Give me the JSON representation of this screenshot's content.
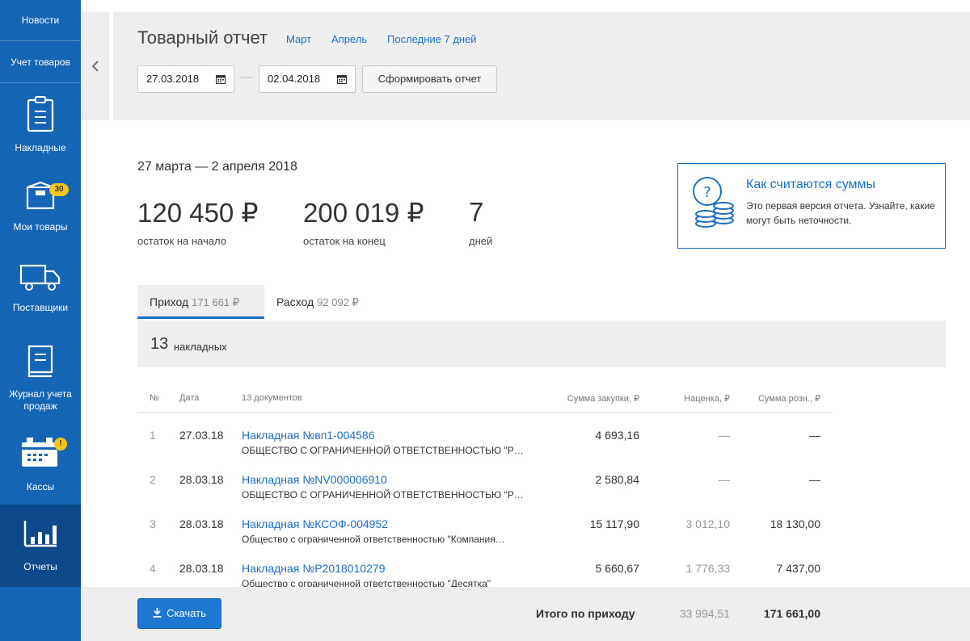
{
  "sidebar": {
    "top_items": [
      "Новости",
      "Учет товаров"
    ],
    "items": [
      {
        "label": "Накладные",
        "icon": "clipboard-icon"
      },
      {
        "label": "Мои товары",
        "icon": "box-icon",
        "badge": "30"
      },
      {
        "label": "Поставщики",
        "icon": "truck-icon"
      },
      {
        "label": "Журнал учета продаж",
        "icon": "book-icon"
      },
      {
        "label": "Кассы",
        "icon": "register-icon",
        "badge": "!"
      },
      {
        "label": "Отчеты",
        "icon": "chart-icon"
      }
    ]
  },
  "header": {
    "title": "Товарный отчет",
    "quick_links": [
      "Март",
      "Апрель",
      "Последние 7 дней"
    ],
    "date_from": "27.03.2018",
    "date_to": "02.04.2018",
    "separator": "—",
    "report_button": "Сформировать отчет"
  },
  "summary": {
    "period": "27 марта — 2 апреля 2018",
    "stats": [
      {
        "value": "120 450 ₽",
        "label": "остаток на начало"
      },
      {
        "value": "200 019 ₽",
        "label": "остаток на конец"
      },
      {
        "value": "7",
        "label": "дней"
      }
    ]
  },
  "info": {
    "title": "Как считаются суммы",
    "text": "Это первая версия отчета. Узнайте, какие могут быть неточности."
  },
  "tabs": [
    {
      "label": "Приход",
      "amount": "171 661 ₽",
      "active": true
    },
    {
      "label": "Расход",
      "amount": "92 092 ₽",
      "active": false
    }
  ],
  "count": {
    "number": "13",
    "label": "накладных"
  },
  "table": {
    "headers": [
      "№",
      "Дата",
      "13 документов",
      "Сумма закупки, ₽",
      "Наценка, ₽",
      "Сумма розн., ₽"
    ],
    "rows": [
      {
        "n": "1",
        "date": "27.03.18",
        "doc": "Накладная №вп1-004586",
        "org": "ОБЩЕСТВО С ОГРАНИЧЕННОЙ ОТВЕТСТВЕННОСТЬЮ \"Р…",
        "purchase": "4 693,16",
        "markup": "—",
        "retail": "—"
      },
      {
        "n": "2",
        "date": "28.03.18",
        "doc": "Накладная №NV000006910",
        "org": "ОБЩЕСТВО С ОГРАНИЧЕННОЙ ОТВЕТСТВЕННОСТЬЮ \"Р…",
        "purchase": "2 580,84",
        "markup": "—",
        "retail": "—"
      },
      {
        "n": "3",
        "date": "28.03.18",
        "doc": "Накладная №КСОФ-004952",
        "org": "Общество с ограниченной ответственностью \"Компания…",
        "purchase": "15 117,90",
        "markup": "3 012,10",
        "retail": "18 130,00"
      },
      {
        "n": "4",
        "date": "28.03.18",
        "doc": "Накладная №Р2018010279",
        "org": "Общество с ограниченной ответственностью \"Десятка\"",
        "purchase": "5 660,67",
        "markup": "1 776,33",
        "retail": "7 437,00"
      }
    ]
  },
  "footer": {
    "download_button": "Скачать",
    "total_label": "Итого по приходу",
    "total_markup": "33 994,51",
    "total_retail": "171 661,00"
  }
}
